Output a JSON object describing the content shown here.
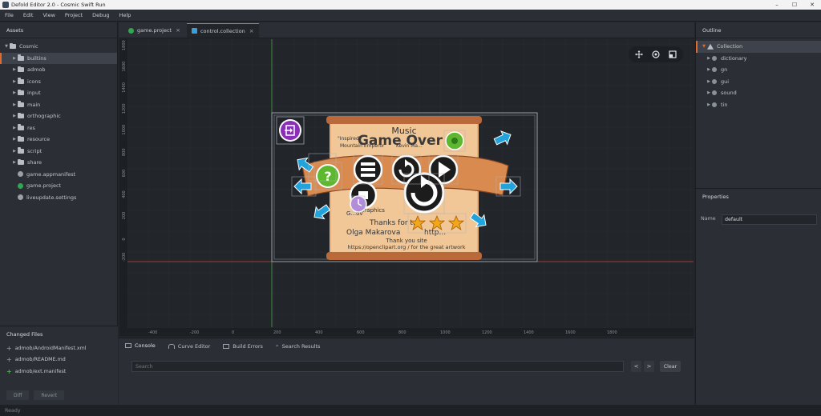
{
  "window": {
    "title": "Defold Editor 2.0 - Cosmic Swift Run",
    "controls": [
      "–",
      "☐",
      "✕"
    ]
  },
  "menu": [
    "File",
    "Edit",
    "View",
    "Project",
    "Debug",
    "Help"
  ],
  "assets": {
    "title": "Assets",
    "items": [
      {
        "label": "Cosmic",
        "type": "folder",
        "expanded": true,
        "depth": 0
      },
      {
        "label": "builtins",
        "type": "folder",
        "depth": 1,
        "selected": true
      },
      {
        "label": "admob",
        "type": "folder",
        "depth": 1
      },
      {
        "label": "icons",
        "type": "folder",
        "depth": 1
      },
      {
        "label": "input",
        "type": "folder",
        "depth": 1
      },
      {
        "label": "main",
        "type": "folder",
        "depth": 1
      },
      {
        "label": "orthographic",
        "type": "folder",
        "depth": 1
      },
      {
        "label": "res",
        "type": "folder",
        "depth": 1
      },
      {
        "label": "resource",
        "type": "folder",
        "depth": 1
      },
      {
        "label": "script",
        "type": "folder",
        "depth": 1
      },
      {
        "label": "share",
        "type": "folder",
        "depth": 1
      },
      {
        "label": "game.appmanifest",
        "type": "gear",
        "depth": 1
      },
      {
        "label": "game.project",
        "type": "green",
        "depth": 1
      },
      {
        "label": "liveupdate.settings",
        "type": "gear",
        "depth": 1
      }
    ]
  },
  "changed_files": {
    "title": "Changed Files",
    "items": [
      "admob/AndroidManifest.xml",
      "admob/README.md",
      "admob/ext.manifest"
    ],
    "diff_label": "Diff",
    "revert_label": "Revert"
  },
  "editor_tabs": [
    {
      "label": "game.project",
      "active": false,
      "icon": "green"
    },
    {
      "label": "control.collection",
      "active": true,
      "icon": "blue"
    }
  ],
  "scene": {
    "x_ticks": [
      "-400",
      "-200",
      "0",
      "200",
      "400",
      "600",
      "800",
      "1000",
      "1200",
      "1400",
      "1600",
      "1800"
    ],
    "y_ticks": [
      "1800",
      "1600",
      "1400",
      "1200",
      "1000",
      "800",
      "600",
      "400",
      "200",
      "0",
      "-200"
    ],
    "overlay": {
      "music": "Music",
      "game_over": "Game Over",
      "credit1": "\"Inspired\"",
      "credit2": "Mountain Emperor",
      "credit3": "Kevin Ma...",
      "credit4": "Graphics",
      "thanks_for": "Thanks for t...",
      "olga": "Olga Makarova",
      "url1": "http...",
      "thank_you": "Thank you site",
      "url2": "https://openclipart.org / for the great artwork",
      "question": "?",
      "gameover_short": "G...ov"
    },
    "colors": {
      "scroll": "#d9965b",
      "arrow": "#22a3dc",
      "purple": "#8b2fb8",
      "green": "#5db82f",
      "star": "#f2a71b",
      "x_axis": "#a23b3b",
      "y_axis": "#3b8a3b"
    }
  },
  "bottom_tabs": [
    {
      "label": "Console",
      "active": true
    },
    {
      "label": "Curve Editor",
      "active": false
    },
    {
      "label": "Build Errors",
      "active": false
    },
    {
      "label": "Search Results",
      "active": false
    }
  ],
  "console": {
    "search_placeholder": "Search",
    "prev": "<",
    "next": ">",
    "clear_label": "Clear"
  },
  "outline": {
    "title": "Outline",
    "root": "Collection",
    "items": [
      "dictionary",
      "gn",
      "gui",
      "sound",
      "tin"
    ]
  },
  "properties": {
    "title": "Properties",
    "name_label": "Name",
    "name_value": "default"
  },
  "status": "Ready"
}
